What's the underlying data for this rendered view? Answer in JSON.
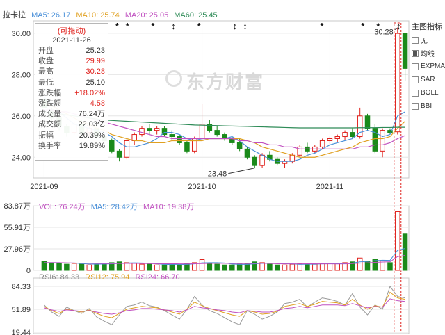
{
  "stock": {
    "name": "拉卡拉"
  },
  "ma_legend": [
    {
      "label": "MA5: 26.17",
      "color": "#4a90d9"
    },
    {
      "label": "MA10: 25.74",
      "color": "#e0a020"
    },
    {
      "label": "MA20: 25.05",
      "color": "#c050c0"
    },
    {
      "label": "MA60: 25.45",
      "color": "#2e8b57"
    }
  ],
  "infobox": {
    "header": "(可拖动)",
    "date": "2021-11-26",
    "rows": [
      {
        "k": "开盘",
        "v": "25.23",
        "color": "#333333"
      },
      {
        "k": "收盘",
        "v": "29.99",
        "color": "#e0201b"
      },
      {
        "k": "最高",
        "v": "30.28",
        "color": "#e0201b"
      },
      {
        "k": "最低",
        "v": "25.10",
        "color": "#333333"
      },
      {
        "k": "涨跌幅",
        "v": "+18.02%",
        "color": "#e0201b"
      },
      {
        "k": "涨跌额",
        "v": "4.58",
        "color": "#e0201b"
      },
      {
        "k": "成交量",
        "v": "76.24万",
        "color": "#333333"
      },
      {
        "k": "成交额",
        "v": "22.03亿",
        "color": "#333333"
      },
      {
        "k": "振幅",
        "v": "20.39%",
        "color": "#333333"
      },
      {
        "k": "换手率",
        "v": "19.89%",
        "color": "#333333"
      }
    ]
  },
  "right_panel": {
    "title": "主图指标",
    "options": [
      {
        "label": "无",
        "checked": false
      },
      {
        "label": "均线",
        "checked": true
      },
      {
        "label": "EXPMA",
        "checked": false
      },
      {
        "label": "SAR",
        "checked": false
      },
      {
        "label": "BOLL",
        "checked": false
      },
      {
        "label": "BBI",
        "checked": false
      }
    ]
  },
  "watermark": "东方财富",
  "price_axis": {
    "labels": [
      "30.00",
      "28.00",
      "26.00",
      "24.00"
    ]
  },
  "date_axis": {
    "labels": [
      "2021-09",
      "2021-10",
      "2021-11"
    ]
  },
  "annotations": {
    "high": "30.28",
    "low": "23.48"
  },
  "vol_legend": [
    {
      "label": "VOL: 76.24万",
      "color": "#c050c0"
    },
    {
      "label": "MA5: 28.42万",
      "color": "#4a90d9"
    },
    {
      "label": "MA10: 19.38万",
      "color": "#c050c0"
    }
  ],
  "vol_axis": {
    "labels": [
      "83.87万",
      "55.91万",
      "27.96万",
      "0"
    ]
  },
  "rsi_legend": [
    {
      "label": "RSI6: 84.33",
      "color": "#888888"
    },
    {
      "label": "RSI12: 75.94",
      "color": "#e0a020"
    },
    {
      "label": "RSI24: 66.70",
      "color": "#c050c0"
    }
  ],
  "rsi_axis": {
    "labels": [
      "84.33",
      "51.89",
      "19.44"
    ]
  },
  "colors": {
    "up": "#e0201b",
    "down": "#1a8a1a",
    "grid": "#e6e6e6"
  },
  "chart_data": {
    "type": "candlestick",
    "y_range": [
      23.0,
      30.6
    ],
    "series": [
      {
        "name": "K",
        "ohlc": [
          [
            26.8,
            26.9,
            26.2,
            26.4
          ],
          [
            26.3,
            26.4,
            25.7,
            25.9
          ],
          [
            25.9,
            26.0,
            25.3,
            25.5
          ],
          [
            25.5,
            25.6,
            25.0,
            25.2
          ],
          [
            25.2,
            25.7,
            25.1,
            25.6
          ],
          [
            25.6,
            25.8,
            25.1,
            25.2
          ],
          [
            25.2,
            25.5,
            25.0,
            25.4
          ],
          [
            25.4,
            25.6,
            24.9,
            25.0
          ],
          [
            25.0,
            25.2,
            24.6,
            24.8
          ],
          [
            24.8,
            24.9,
            24.2,
            24.3
          ],
          [
            24.3,
            24.4,
            23.8,
            24.0
          ],
          [
            24.0,
            24.9,
            23.9,
            24.8
          ],
          [
            24.8,
            25.2,
            24.6,
            25.1
          ],
          [
            25.1,
            25.5,
            25.0,
            25.4
          ],
          [
            25.4,
            25.6,
            25.1,
            25.3
          ],
          [
            25.3,
            25.5,
            25.1,
            25.4
          ],
          [
            25.4,
            25.5,
            25.0,
            25.1
          ],
          [
            25.1,
            25.3,
            24.8,
            25.0
          ],
          [
            25.0,
            25.1,
            24.6,
            24.7
          ],
          [
            24.7,
            24.8,
            24.2,
            24.3
          ],
          [
            24.3,
            25.0,
            24.2,
            24.9
          ],
          [
            24.9,
            26.6,
            24.8,
            25.6
          ],
          [
            25.6,
            25.8,
            25.2,
            25.3
          ],
          [
            25.3,
            25.5,
            25.0,
            25.1
          ],
          [
            25.1,
            25.2,
            24.8,
            24.9
          ],
          [
            24.9,
            25.0,
            24.6,
            24.7
          ],
          [
            24.7,
            24.9,
            24.3,
            24.4
          ],
          [
            24.4,
            24.5,
            23.9,
            24.0
          ],
          [
            24.0,
            24.1,
            23.48,
            23.6
          ],
          [
            23.6,
            24.2,
            23.5,
            24.1
          ],
          [
            24.1,
            24.3,
            23.8,
            23.9
          ],
          [
            23.9,
            24.0,
            23.6,
            23.7
          ],
          [
            23.7,
            23.9,
            23.5,
            23.8
          ],
          [
            23.8,
            24.2,
            23.7,
            24.1
          ],
          [
            24.1,
            24.6,
            24.0,
            24.5
          ],
          [
            24.5,
            24.7,
            24.2,
            24.3
          ],
          [
            24.3,
            24.6,
            24.2,
            24.5
          ],
          [
            24.5,
            24.9,
            24.4,
            24.8
          ],
          [
            24.8,
            25.0,
            24.6,
            24.9
          ],
          [
            24.9,
            25.1,
            24.7,
            25.0
          ],
          [
            25.0,
            25.3,
            24.8,
            25.2
          ],
          [
            25.2,
            25.4,
            24.9,
            25.0
          ],
          [
            25.0,
            26.4,
            24.9,
            26.0
          ],
          [
            26.0,
            26.1,
            25.3,
            25.4
          ],
          [
            25.4,
            25.6,
            24.2,
            24.3
          ],
          [
            24.3,
            25.4,
            24.0,
            25.3
          ],
          [
            25.3,
            25.4,
            25.1,
            25.2
          ],
          [
            25.23,
            30.28,
            25.1,
            29.99
          ],
          [
            29.99,
            30.0,
            27.7,
            28.3
          ]
        ]
      },
      {
        "name": "MA5",
        "values": [
          26.9,
          26.6,
          26.2,
          25.9,
          25.6,
          25.5,
          25.4,
          25.3,
          25.2,
          25.0,
          24.7,
          24.5,
          24.5,
          24.6,
          24.7,
          24.9,
          25.2,
          25.2,
          25.1,
          24.9,
          24.8,
          24.9,
          24.9,
          24.9,
          24.9,
          25.0,
          24.8,
          24.5,
          24.3,
          24.1,
          23.9,
          23.8,
          23.8,
          23.8,
          23.9,
          24.1,
          24.2,
          24.4,
          24.6,
          24.7,
          24.8,
          24.9,
          25.2,
          25.3,
          25.2,
          25.0,
          25.1,
          26.0,
          26.2
        ]
      },
      {
        "name": "MA10",
        "values": [
          26.6,
          26.5,
          26.3,
          26.1,
          25.9,
          25.7,
          25.6,
          25.4,
          25.3,
          25.1,
          25.0,
          24.9,
          24.8,
          24.8,
          24.7,
          24.7,
          24.7,
          24.8,
          24.8,
          24.8,
          24.8,
          24.8,
          24.9,
          24.9,
          24.9,
          24.9,
          24.9,
          24.8,
          24.7,
          24.5,
          24.4,
          24.3,
          24.2,
          24.1,
          24.0,
          24.0,
          24.0,
          24.1,
          24.2,
          24.3,
          24.4,
          24.5,
          24.7,
          24.8,
          24.9,
          24.9,
          25.0,
          25.4,
          25.74
        ]
      },
      {
        "name": "MA20",
        "values": [
          26.3,
          26.3,
          26.2,
          26.2,
          26.1,
          26.0,
          25.9,
          25.8,
          25.7,
          25.6,
          25.5,
          25.4,
          25.3,
          25.2,
          25.1,
          25.0,
          25.0,
          24.9,
          24.9,
          24.9,
          24.9,
          24.9,
          24.9,
          24.9,
          24.9,
          24.9,
          24.8,
          24.8,
          24.7,
          24.7,
          24.6,
          24.6,
          24.5,
          24.5,
          24.4,
          24.4,
          24.4,
          24.4,
          24.4,
          24.4,
          24.4,
          24.4,
          24.5,
          24.5,
          24.6,
          24.6,
          24.7,
          24.9,
          25.05
        ]
      },
      {
        "name": "MA60",
        "values": [
          26.2,
          26.15,
          26.1,
          26.05,
          26.0,
          25.95,
          25.9,
          25.85,
          25.8,
          25.78,
          25.76,
          25.74,
          25.72,
          25.7,
          25.68,
          25.66,
          25.64,
          25.62,
          25.6,
          25.58,
          25.56,
          25.55,
          25.54,
          25.53,
          25.52,
          25.51,
          25.5,
          25.49,
          25.48,
          25.47,
          25.46,
          25.45,
          25.44,
          25.43,
          25.42,
          25.42,
          25.42,
          25.42,
          25.42,
          25.42,
          25.42,
          25.42,
          25.43,
          25.43,
          25.43,
          25.44,
          25.44,
          25.45,
          25.45
        ]
      }
    ],
    "volume": {
      "y_range": [
        0,
        83.87
      ],
      "values": [
        12,
        10,
        9,
        8,
        9,
        8,
        7,
        8,
        9,
        10,
        11,
        10,
        9,
        8,
        8,
        7,
        7,
        8,
        8,
        9,
        10,
        14,
        9,
        8,
        7,
        7,
        8,
        9,
        11,
        10,
        8,
        7,
        7,
        8,
        9,
        8,
        8,
        9,
        9,
        9,
        10,
        11,
        16,
        12,
        14,
        13,
        10,
        76.24,
        48
      ],
      "ma5": [
        10,
        10,
        10,
        9.5,
        9.6,
        8.8,
        8.2,
        8.0,
        8.2,
        8.4,
        9.0,
        9.6,
        9.8,
        9.6,
        9.2,
        8.4,
        7.8,
        7.6,
        7.6,
        7.8,
        8.4,
        9.8,
        10,
        10,
        9.6,
        8.2,
        7.8,
        7.8,
        8.4,
        9.0,
        9.2,
        9.0,
        8.6,
        8.4,
        7.8,
        8.0,
        8.0,
        8.4,
        8.6,
        8.6,
        9.0,
        9.6,
        11,
        11.6,
        12.6,
        13.2,
        13,
        26,
        28.42
      ],
      "ma10": [
        10,
        10,
        10,
        9.8,
        9.6,
        9.4,
        9.2,
        9.0,
        8.8,
        8.8,
        8.9,
        9.0,
        9.0,
        8.9,
        8.8,
        8.7,
        8.6,
        8.6,
        8.5,
        8.5,
        8.6,
        8.8,
        9.0,
        9.1,
        9.1,
        9.0,
        8.8,
        8.8,
        9.0,
        9.2,
        9.0,
        8.6,
        8.4,
        8.4,
        8.5,
        8.6,
        8.6,
        8.5,
        8.4,
        8.3,
        8.4,
        8.8,
        9.4,
        9.8,
        10.4,
        10.8,
        11.2,
        17.8,
        19.38
      ]
    },
    "rsi": {
      "y_range": [
        19.44,
        84.33
      ],
      "rsi6": [
        58,
        48,
        42,
        55,
        50,
        46,
        53,
        41,
        35,
        30,
        44,
        56,
        58,
        62,
        57,
        55,
        50,
        44,
        38,
        52,
        70,
        58,
        50,
        46,
        40,
        34,
        30,
        50,
        45,
        38,
        42,
        48,
        60,
        62,
        66,
        55,
        62,
        68,
        66,
        63,
        58,
        74,
        55,
        44,
        58,
        52,
        84.33,
        70,
        68
      ],
      "rsi12": [
        56,
        50,
        46,
        52,
        50,
        48,
        51,
        46,
        42,
        40,
        46,
        52,
        54,
        56,
        55,
        54,
        51,
        48,
        45,
        52,
        62,
        57,
        53,
        50,
        47,
        44,
        42,
        50,
        48,
        45,
        46,
        49,
        56,
        58,
        60,
        56,
        59,
        63,
        62,
        61,
        58,
        66,
        58,
        52,
        57,
        55,
        75.94,
        68,
        66
      ],
      "rsi24": [
        54,
        51,
        49,
        51,
        50,
        49,
        50,
        48,
        46,
        45,
        47,
        50,
        51,
        53,
        53,
        52,
        51,
        50,
        48,
        51,
        56,
        54,
        53,
        51,
        50,
        48,
        47,
        50,
        49,
        48,
        48,
        50,
        53,
        54,
        56,
        54,
        56,
        58,
        58,
        58,
        57,
        60,
        57,
        54,
        56,
        55,
        66.7,
        64,
        63
      ]
    }
  }
}
